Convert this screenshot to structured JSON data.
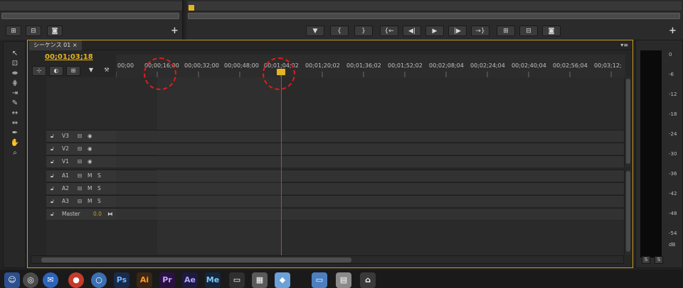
{
  "source_monitor": {
    "buttons": [
      "insert-icon",
      "overwrite-icon",
      "camera-icon"
    ],
    "add_label": "+"
  },
  "program_monitor": {
    "transport": [
      "marker-icon",
      "{",
      "}",
      "{←",
      "◀|",
      "▶",
      "|▶",
      "→}",
      "lift-icon",
      "extract-icon",
      "camera-icon"
    ],
    "add_label": "+"
  },
  "sequence": {
    "tab_label": "シーケンス 01 ×",
    "timecode": "00;01;03;18",
    "panel_menu": "▾≡",
    "ruler_labels": [
      "00;00",
      "00;00;16;00",
      "00;00;32;00",
      "00;00;48;00",
      "00;01;04;02",
      "00;01;20;02",
      "00;01;36;02",
      "00;01;52;02",
      "00;02;08;04",
      "00;02;24;04",
      "00;02;40;04",
      "00;02;56;04",
      "00;03;12;"
    ],
    "video_tracks": [
      {
        "name": "V3"
      },
      {
        "name": "V2"
      },
      {
        "name": "V1"
      }
    ],
    "audio_tracks": [
      {
        "name": "A1",
        "m": "M",
        "s": "S"
      },
      {
        "name": "A2",
        "m": "M",
        "s": "S"
      },
      {
        "name": "A3",
        "m": "M",
        "s": "S"
      }
    ],
    "master": {
      "name": "Master",
      "value": "0.0"
    }
  },
  "meter": {
    "db_labels": [
      "0",
      "-6",
      "-12",
      "-18",
      "-24",
      "-30",
      "-36",
      "-42",
      "-48",
      "-54",
      "dB"
    ],
    "solo_buttons": [
      "S",
      "S"
    ]
  },
  "colors": {
    "accent": "#e6b420",
    "playhead": "#d83a2a",
    "annotation": "#d81e1e"
  }
}
